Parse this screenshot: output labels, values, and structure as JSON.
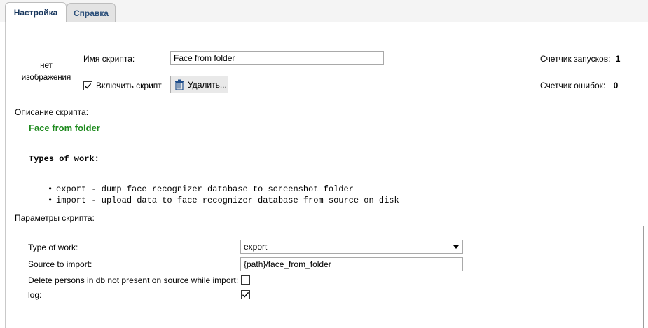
{
  "tabs": [
    {
      "label": "Настройка",
      "active": true
    },
    {
      "label": "Справка",
      "active": false
    }
  ],
  "header": {
    "no_image_label": "нет изображения",
    "script_name_label": "Имя скрипта:",
    "script_name_value": "Face from folder",
    "enable_script_label": "Включить скрипт",
    "enable_script_checked": true,
    "delete_button_label": "Удалить...",
    "run_counter_label": "Счетчик запусков:",
    "run_counter_value": "1",
    "error_counter_label": "Счетчик ошибок:",
    "error_counter_value": "0"
  },
  "description": {
    "label": "Описание скрипта:",
    "title": "Face from folder",
    "types_heading": "Types of work:",
    "items": [
      "export - dump face recognizer database to screenshot folder",
      "import - upload data to face recognizer database from source on disk"
    ]
  },
  "params": {
    "label": "Параметры скрипта:",
    "type_of_work_label": "Type of work:",
    "type_of_work_value": "export",
    "source_label": "Source to import:",
    "source_value": "{path}/face_from_folder",
    "delete_persons_label": "Delete persons in db not present on source while import:",
    "delete_persons_checked": false,
    "log_label": "log:",
    "log_checked": true
  },
  "colors": {
    "accent_title": "#1e8a1e",
    "tab_active_text": "#17365d"
  },
  "icons": {
    "delete": "trash-icon",
    "dropdown": "chevron-down-icon",
    "check": "checkmark-icon"
  }
}
